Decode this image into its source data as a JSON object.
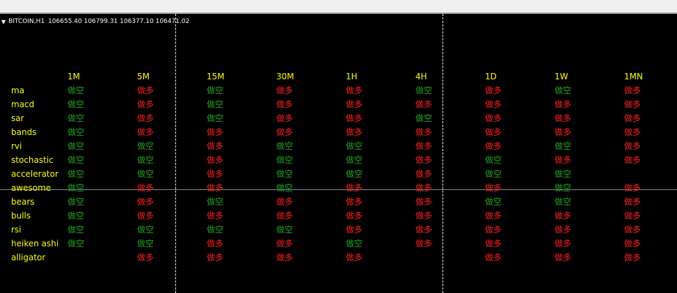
{
  "header": {
    "symbol": "BITCOIN,H1",
    "ohlc": "106655.40 106799.31 106377.10 106471.02"
  },
  "colors": {
    "bull": "#ff2020",
    "bear": "#22a322",
    "label": "#ffff00"
  },
  "labels": {
    "bull": "做多",
    "bear": "做空"
  },
  "timeframes": [
    "1M",
    "5M",
    "15M",
    "30M",
    "1H",
    "4H",
    "1D",
    "1W",
    "1MN"
  ],
  "indicators": [
    {
      "name": "ma",
      "signals": [
        "bear",
        "bull",
        "bear",
        "bull",
        "bull",
        "bear",
        "bull",
        "bear",
        "bull"
      ]
    },
    {
      "name": "macd",
      "signals": [
        "bear",
        "bull",
        "bear",
        "bull",
        "bull",
        "bull",
        "bull",
        "bull",
        "bull"
      ]
    },
    {
      "name": "sar",
      "signals": [
        "bear",
        "bull",
        "bear",
        "bull",
        "bull",
        "bear",
        "bull",
        "bull",
        "bull"
      ]
    },
    {
      "name": "bands",
      "signals": [
        "bear",
        "bull",
        "bull",
        "bull",
        "bull",
        "bull",
        "bull",
        "bull",
        "bull"
      ]
    },
    {
      "name": "rvi",
      "signals": [
        "bear",
        "bear",
        "bull",
        "bear",
        "bear",
        "bull",
        "bull",
        "bear",
        "bull"
      ]
    },
    {
      "name": "stochastic",
      "signals": [
        "bear",
        "bear",
        "bull",
        "bear",
        "bear",
        "bull",
        "bear",
        "bull",
        "bull"
      ]
    },
    {
      "name": "accelerator",
      "signals": [
        "bear",
        "bear",
        "bull",
        "bear",
        "bear",
        "bull",
        "bear",
        "bear",
        ""
      ]
    },
    {
      "name": "awesome",
      "signals": [
        "bear",
        "bull",
        "bull",
        "bear",
        "bull",
        "bull",
        "bull",
        "bear",
        "bull"
      ]
    },
    {
      "name": "bears",
      "signals": [
        "bear",
        "bull",
        "bear",
        "bull",
        "bull",
        "bull",
        "bear",
        "bear",
        "bull"
      ]
    },
    {
      "name": "bulls",
      "signals": [
        "bear",
        "bull",
        "bull",
        "bull",
        "bull",
        "bull",
        "bull",
        "bull",
        "bull"
      ]
    },
    {
      "name": "rsi",
      "signals": [
        "bear",
        "bear",
        "bear",
        "bear",
        "bull",
        "bull",
        "bull",
        "bull",
        "bull"
      ]
    },
    {
      "name": "heiken ashi",
      "signals": [
        "bear",
        "bear",
        "bull",
        "bull",
        "bear",
        "bull",
        "bull",
        "bull",
        "bull"
      ]
    },
    {
      "name": "alligator",
      "signals": [
        "",
        "bull",
        "bull",
        "bull",
        "bull",
        "",
        "bull",
        "bull",
        "bull"
      ]
    }
  ]
}
